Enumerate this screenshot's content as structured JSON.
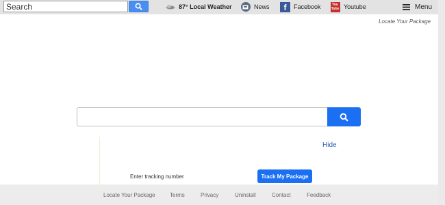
{
  "toolbar": {
    "search_placeholder": "Search",
    "weather_label": "87° Local Weather",
    "news_label": "News",
    "facebook_label": "Facebook",
    "youtube_label": "Youtube",
    "menu_label": "Menu"
  },
  "header_link": "Locate Your Package",
  "main_search": {
    "value": ""
  },
  "tracking": {
    "hide_label": "Hide",
    "input_label": "Enter tracking number",
    "button_label": "Track My Package"
  },
  "footer": {
    "links": [
      "Locate Your Package",
      "Terms",
      "Privacy",
      "Uninstall",
      "Contact",
      "Feedback"
    ]
  },
  "colors": {
    "accent": "#1a6ff2",
    "toolbar_bg": "#e3e3e3",
    "footer_bg": "#ececec",
    "link": "#2a5db0"
  }
}
